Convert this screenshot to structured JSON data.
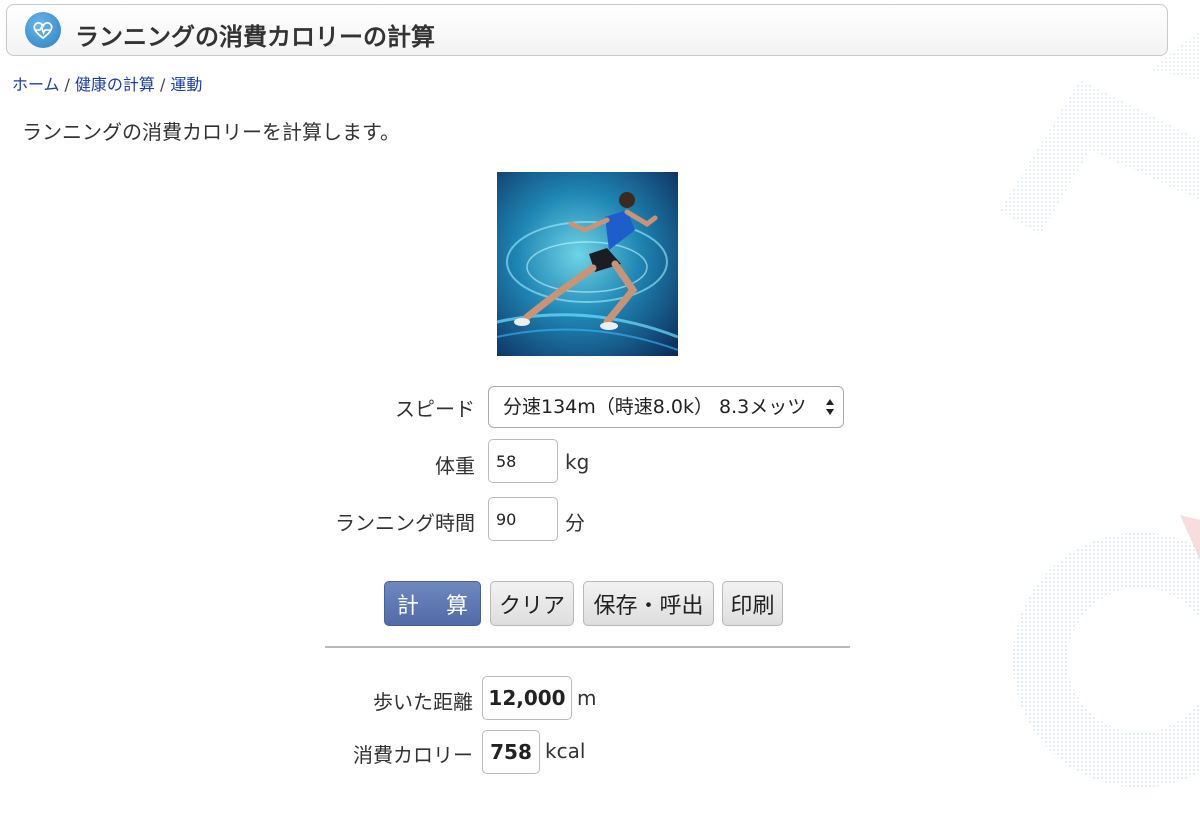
{
  "header": {
    "title": "ランニングの消費カロリーの計算",
    "icon": "heart-pulse-icon"
  },
  "breadcrumb": {
    "items": [
      "ホーム",
      "健康の計算",
      "運動"
    ],
    "separator": "/"
  },
  "intro": "ランニングの消費カロリーを計算します。",
  "image": {
    "alt": "running-man-image"
  },
  "form": {
    "speed": {
      "label": "スピード",
      "selected": "分速134m（時速8.0k） 8.3メッツ"
    },
    "weight": {
      "label": "体重",
      "value": "58",
      "unit": "kg"
    },
    "time": {
      "label": "ランニング時間",
      "value": "90",
      "unit": "分"
    }
  },
  "buttons": {
    "calculate": "計 算",
    "clear": "クリア",
    "save_load": "保存・呼出",
    "print": "印刷"
  },
  "results": {
    "distance": {
      "label": "歩いた距離",
      "value": "12,000",
      "unit": "m"
    },
    "calories": {
      "label": "消費カロリー",
      "value": "758",
      "unit": "kcal"
    }
  },
  "colors": {
    "primary_button": "#5d76b3",
    "link": "#1a3fa0",
    "icon_blue": "#3b8fd2"
  }
}
